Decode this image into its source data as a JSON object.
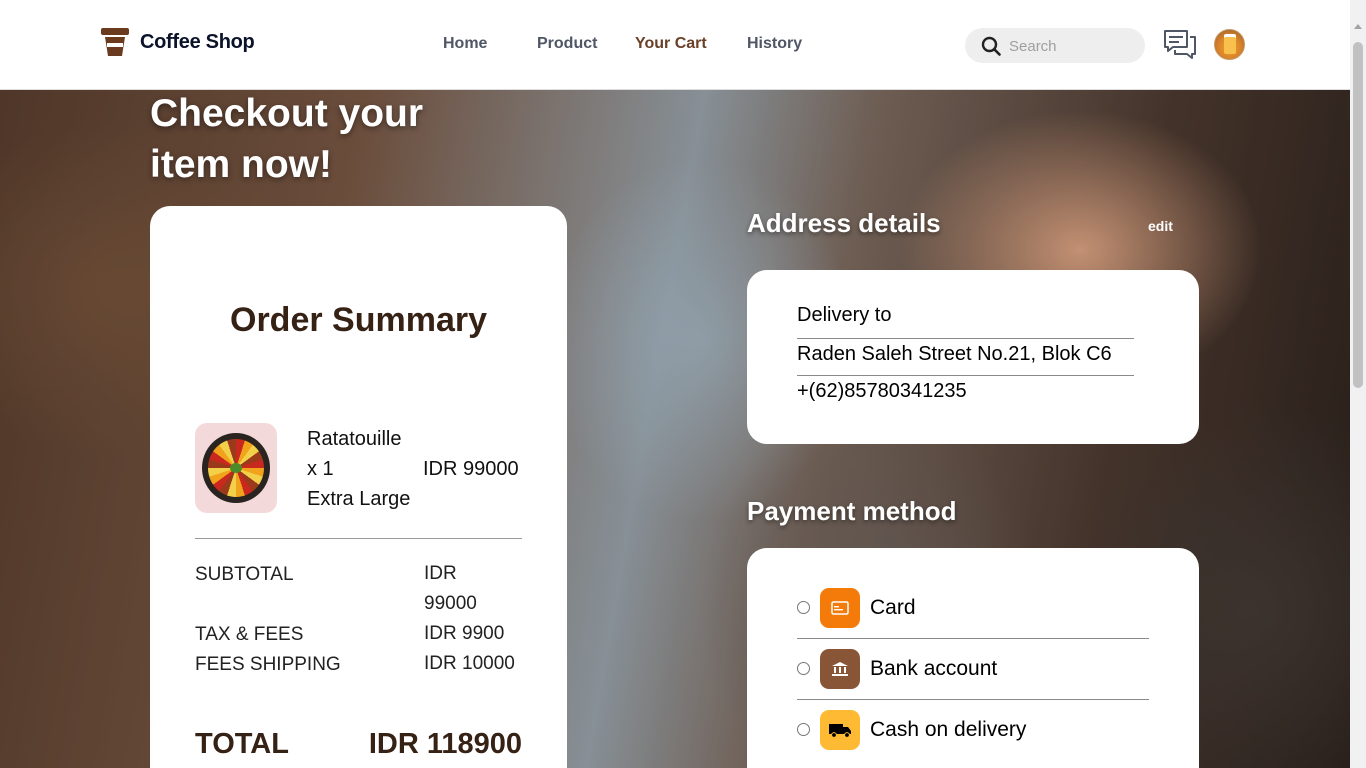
{
  "brand": {
    "name": "Coffee Shop"
  },
  "nav": {
    "items": [
      {
        "label": "Home"
      },
      {
        "label": "Product"
      },
      {
        "label": "Your Cart"
      },
      {
        "label": "History"
      }
    ],
    "active": "Your Cart",
    "active_color": "#6A4029"
  },
  "search": {
    "placeholder": "Search"
  },
  "page": {
    "title": "Checkout your item now!"
  },
  "order_summary": {
    "title": "Order Summary",
    "item": {
      "name": "Ratatouille",
      "quantity": "x 1",
      "size": "Extra Large",
      "price": "IDR 99000"
    },
    "subtotal": {
      "label": "SUBTOTAL",
      "value": "IDR 99000"
    },
    "tax": {
      "label": "TAX & FEES",
      "value": "IDR 9900"
    },
    "shipping": {
      "label": "FEES SHIPPING",
      "value": "IDR 10000"
    },
    "total": {
      "label": "TOTAL",
      "value": "IDR 118900"
    }
  },
  "address": {
    "section_title": "Address details",
    "edit_label": "edit",
    "delivery_to": "Delivery to",
    "street": "Raden Saleh Street No.21, Blok C6",
    "phone": "+(62)85780341235"
  },
  "payment": {
    "section_title": "Payment method",
    "options": [
      {
        "label": "Card",
        "icon": "card-icon",
        "color": "#F47B0A"
      },
      {
        "label": "Bank account",
        "icon": "bank-icon",
        "color": "#895537"
      },
      {
        "label": "Cash on delivery",
        "icon": "truck-icon",
        "color": "#FFBA33"
      }
    ]
  }
}
